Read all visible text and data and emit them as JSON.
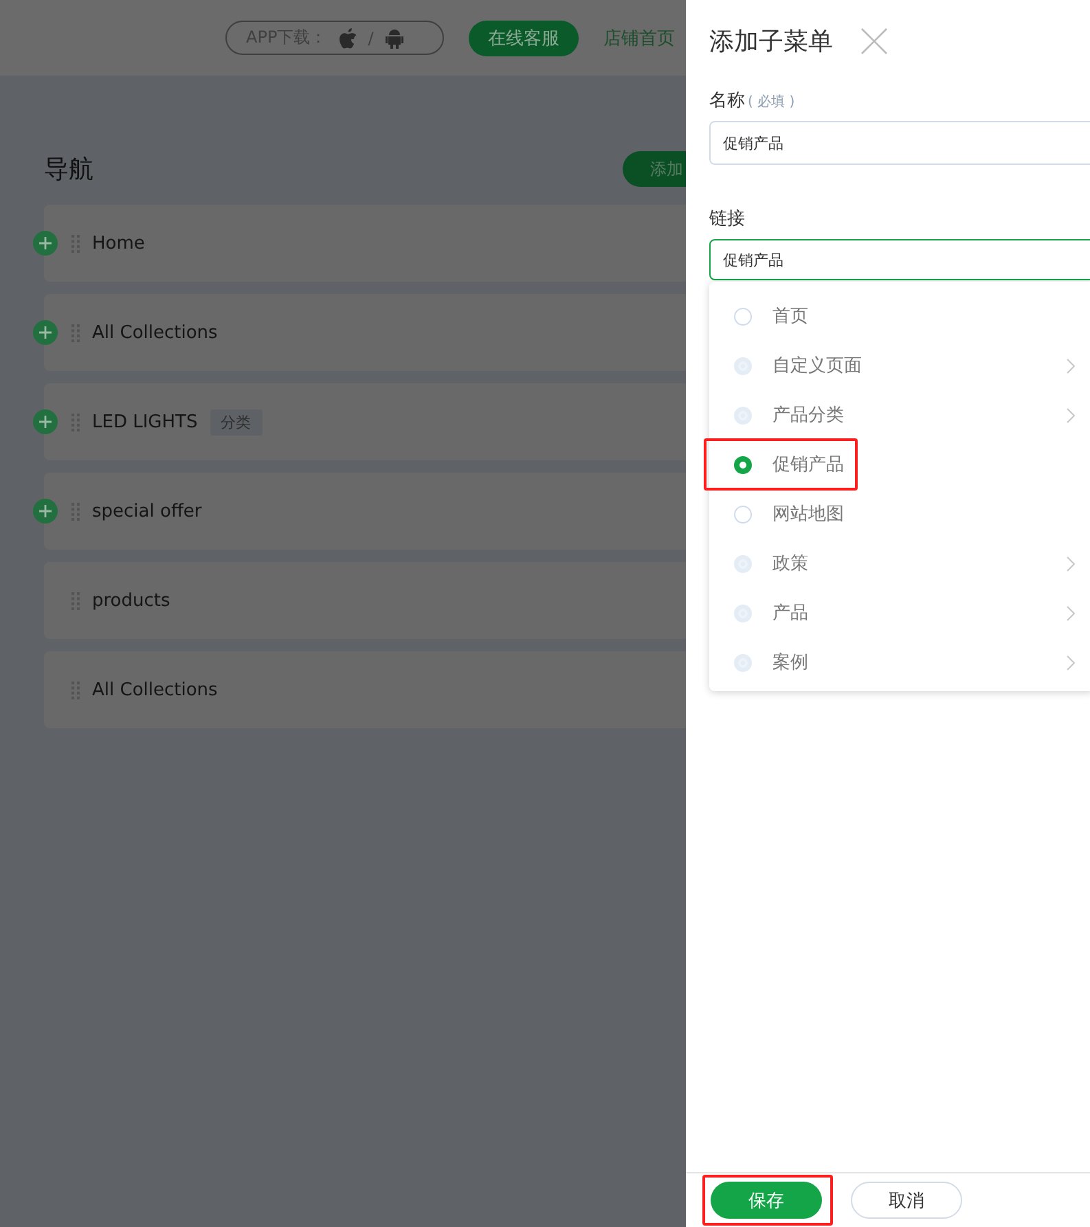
{
  "header": {
    "app_download": "APP下载：",
    "separator": "/",
    "service_button": "在线客服",
    "store_link": "店铺首页"
  },
  "navigation": {
    "title": "导航",
    "add_button": "添加",
    "items": [
      {
        "label": "Home",
        "addable": true
      },
      {
        "label": "All Collections",
        "addable": true
      },
      {
        "label": "LED LIGHTS",
        "addable": true,
        "tag": "分类"
      },
      {
        "label": "special offer",
        "addable": true
      },
      {
        "label": "products",
        "addable": false
      },
      {
        "label": "All Collections",
        "addable": false
      }
    ]
  },
  "panel": {
    "title": "添加子菜单",
    "name_label": "名称",
    "name_hint": "( 必填 )",
    "name_value": "促销产品",
    "link_label": "链接",
    "link_value": "促销产品",
    "options": [
      {
        "label": "首页",
        "selected": false,
        "has_children": false,
        "highlighted": false
      },
      {
        "label": "自定义页面",
        "selected": false,
        "has_children": true,
        "highlighted": false
      },
      {
        "label": "产品分类",
        "selected": false,
        "has_children": true,
        "highlighted": false
      },
      {
        "label": "促销产品",
        "selected": true,
        "has_children": false,
        "highlighted": true
      },
      {
        "label": "网站地图",
        "selected": false,
        "has_children": false,
        "highlighted": false
      },
      {
        "label": "政策",
        "selected": false,
        "has_children": true,
        "highlighted": false
      },
      {
        "label": "产品",
        "selected": false,
        "has_children": true,
        "highlighted": false
      },
      {
        "label": "案例",
        "selected": false,
        "has_children": true,
        "highlighted": false
      }
    ],
    "save_button": {
      "label": "保存",
      "highlighted": true
    },
    "cancel_button": "取消"
  }
}
